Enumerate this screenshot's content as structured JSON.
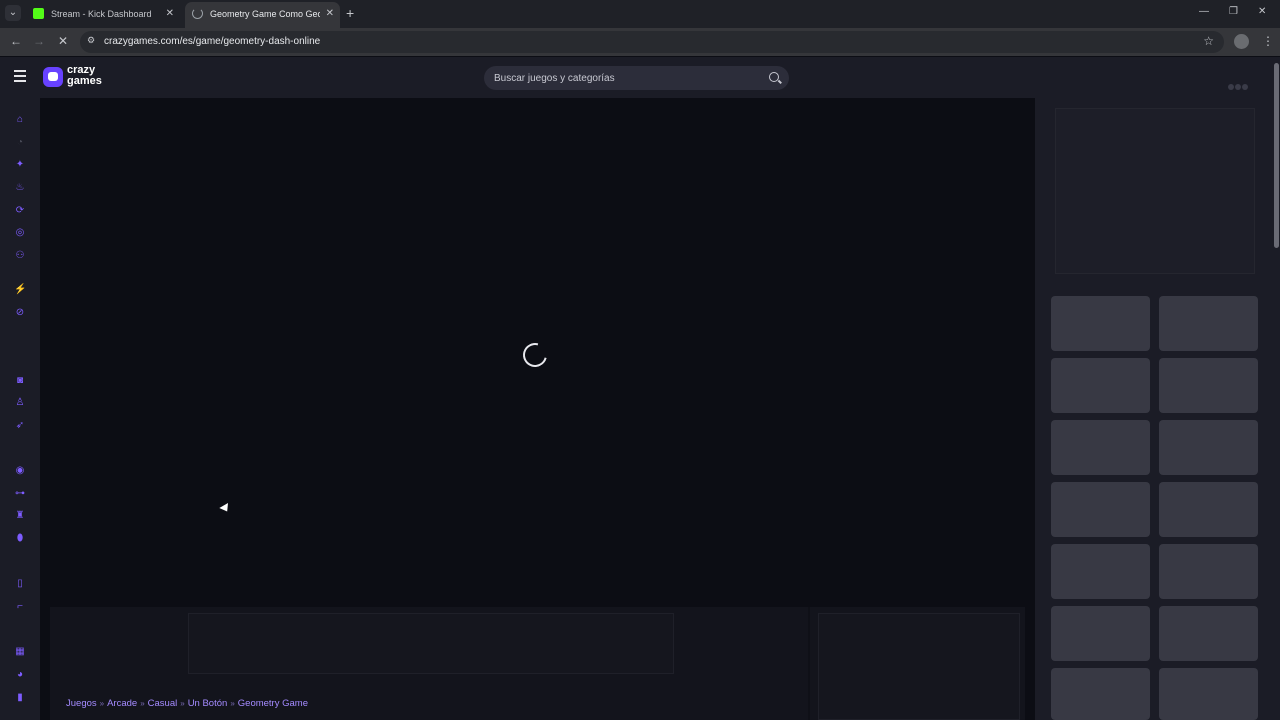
{
  "browser": {
    "tabs": [
      {
        "title": "Stream - Kick Dashboard",
        "favicon": "kick-icon",
        "active": false
      },
      {
        "title": "Geometry Game Como Geometry Dash",
        "favicon": "loading-spinner-icon",
        "active": true
      }
    ],
    "url": "crazygames.com/es/game/geometry-dash-online"
  },
  "site": {
    "logo_text": "crazy games",
    "search_placeholder": "Buscar juegos y categorías",
    "accent_color": "#7d5cff"
  },
  "sidebar_icons": [
    "home-icon",
    "clock-icon",
    "sparkle-icon",
    "fire-icon",
    "refresh-icon",
    "multiplayer-icon",
    "friends-icon",
    "lightning-icon",
    "compass-icon",
    "puzzle-icon",
    "person-icon",
    "rocket-icon",
    "steering-wheel-icon",
    "gamepad-icon",
    "chess-icon",
    "football-icon",
    "door-icon",
    "gun-icon",
    "building-icon",
    "pacman-icon",
    "card-icon"
  ],
  "breadcrumb": [
    "Juegos",
    "Arcade",
    "Casual",
    "Un Botón",
    "Geometry Game"
  ]
}
